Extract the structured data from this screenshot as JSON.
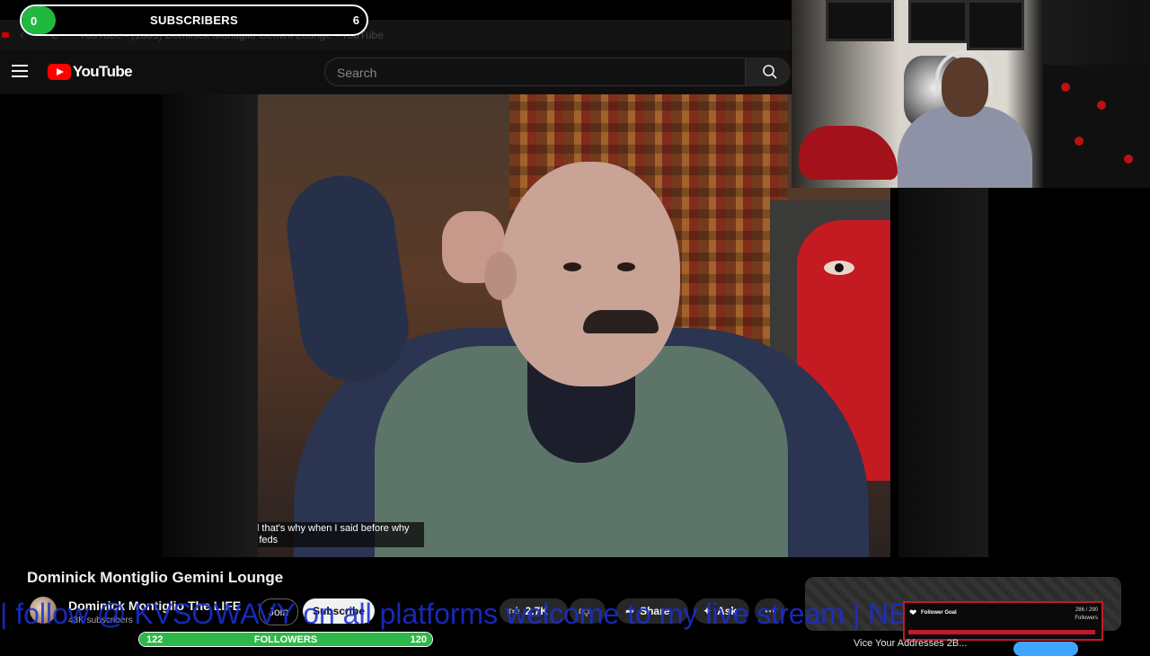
{
  "browser": {
    "tab_title": "YouTube - (1803) Dominick Montiglio Gemini Lounge - YouTube"
  },
  "header": {
    "logo_text": "YouTube",
    "search_placeholder": "Search"
  },
  "overlay": {
    "subscriber_goal": {
      "current": "0",
      "label": "SUBSCRIBERS",
      "target": "6",
      "progress": 0.1
    },
    "ticker_text": "| follow @ KVSOWAVY on all platforms welcome to my live stream | NEW",
    "follower_goal_widget": {
      "title": "Follower Goal",
      "count": "286 / 290",
      "unit": "Followers",
      "progress": 0.98
    },
    "followers_bar": {
      "left": "122",
      "label": "FOLLOWERS",
      "right": "120",
      "progress": 1.0
    }
  },
  "video": {
    "subtitle": "and that's why when I said before why the feds",
    "title": "Dominick Montiglio Gemini Lounge"
  },
  "channel": {
    "name": "Dominick Montiglio The LIFE",
    "subs": "43K subscribers",
    "join_label": "Join",
    "subscribe_label": "Subscribe",
    "like_count": "2.7K",
    "share_label": "Share",
    "ask_label": "Ask"
  },
  "recommended": {
    "partial_text": "Vice Your Addresses 2B..."
  },
  "colors": {
    "youtube_red": "#ff0000",
    "goal_green": "#21b83f",
    "ticker_blue": "#1b2fd0",
    "follower_goal_red": "#c21a26"
  }
}
